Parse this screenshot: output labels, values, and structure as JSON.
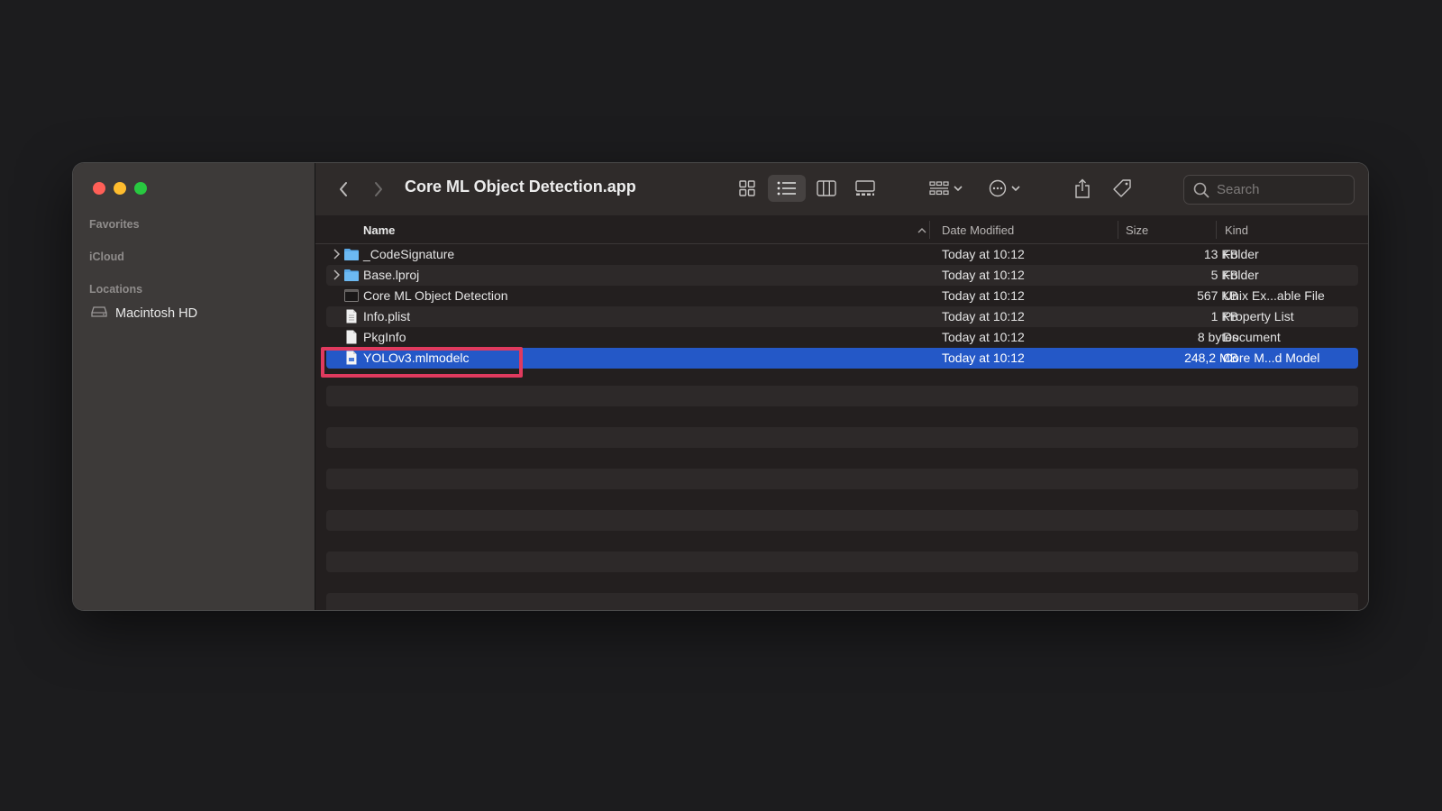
{
  "window": {
    "title": "Core ML Object Detection.app"
  },
  "sidebar": {
    "sections": {
      "favorites": "Favorites",
      "icloud": "iCloud",
      "locations": "Locations"
    },
    "items": [
      {
        "label": "Macintosh HD",
        "icon": "hard-drive-icon"
      }
    ]
  },
  "toolbar": {
    "back_icon": "chevron-left-icon",
    "forward_icon": "chevron-right-icon",
    "view_modes": [
      "icon-view",
      "list-view",
      "column-view",
      "gallery-view"
    ],
    "active_view": "list-view",
    "search_placeholder": "Search"
  },
  "columns": {
    "name": "Name",
    "date": "Date Modified",
    "size": "Size",
    "kind": "Kind"
  },
  "files": [
    {
      "name": "_CodeSignature",
      "date": "Today at 10:12",
      "size": "13 KB",
      "kind": "Folder",
      "type": "folder",
      "expandable": true
    },
    {
      "name": "Base.lproj",
      "date": "Today at 10:12",
      "size": "5 KB",
      "kind": "Folder",
      "type": "folder",
      "expandable": true
    },
    {
      "name": "Core ML Object Detection",
      "date": "Today at 10:12",
      "size": "567 KB",
      "kind": "Unix Ex...able File",
      "type": "exec",
      "expandable": false
    },
    {
      "name": "Info.plist",
      "date": "Today at 10:12",
      "size": "1 KB",
      "kind": "Property List",
      "type": "doc",
      "expandable": false
    },
    {
      "name": "PkgInfo",
      "date": "Today at 10:12",
      "size": "8 bytes",
      "kind": "Document",
      "type": "doc",
      "expandable": false
    },
    {
      "name": "YOLOv3.mlmodelc",
      "date": "Today at 10:12",
      "size": "248,2 MB",
      "kind": "Core M...d Model",
      "type": "doc",
      "expandable": false,
      "selected": true
    }
  ],
  "colors": {
    "selection": "#2458c7",
    "highlight_box": "#e03a5e",
    "folder": "#5aa9e8"
  }
}
